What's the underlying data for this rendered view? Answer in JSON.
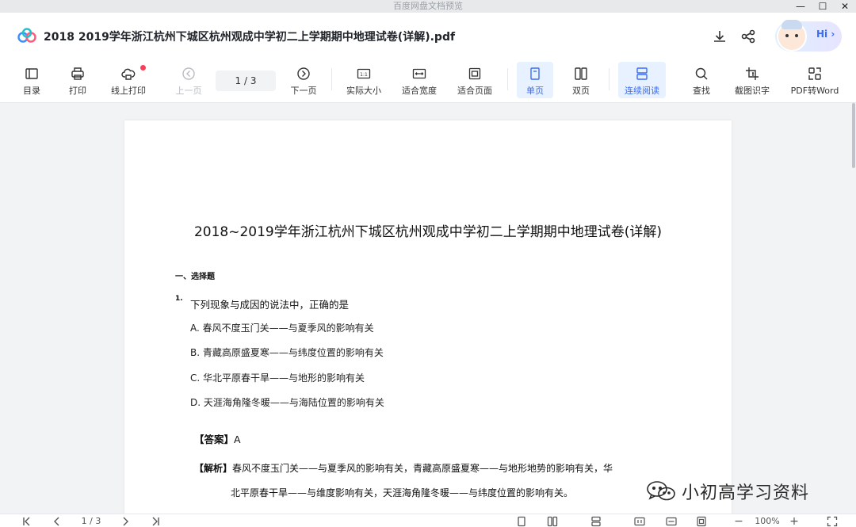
{
  "window": {
    "app_title": "百度网盘文档预览",
    "controls": {
      "minimize": "—",
      "maximize": "☐",
      "close": "✕"
    }
  },
  "header": {
    "doc_title": "2018  2019学年浙江杭州下城区杭州观成中学初二上学期期中地理试卷(详解).pdf",
    "assistant_label": "Hi ›",
    "icons": [
      "download-icon",
      "share-icon",
      "assistant-avatar"
    ]
  },
  "toolbar": {
    "catalog": "目录",
    "print": "打印",
    "online_print": "线上打印",
    "prev_page": "上一页",
    "page_indicator": "1  /  3",
    "next_page": "下一页",
    "actual_size": "实际大小",
    "fit_width": "适合宽度",
    "fit_page": "适合页面",
    "single_page": "单页",
    "double_page": "双页",
    "continuous": "连续阅读",
    "find": "查找",
    "ocr": "截图识字",
    "pdf_to_word": "PDF转Word"
  },
  "document": {
    "title": "2018~2019学年浙江杭州下城区杭州观成中学初二上学期期中地理试卷(详解)",
    "section": "一、选择题",
    "question_number": "1.",
    "question": "下列现象与成因的说法中，正确的是",
    "options": [
      "A. 春风不度玉门关——与夏季风的影响有关",
      "B. 青藏高原盛夏寒——与纬度位置的影响有关",
      "C. 华北平原春干旱——与地形的影响有关",
      "D. 天涯海角隆冬暖——与海陆位置的影响有关"
    ],
    "answer_label": "【答案】",
    "answer_value": "A",
    "explanation_label": "【解析】",
    "explanation_line1": "春风不度玉门关——与夏季风的影响有关，青藏高原盛夏寒——与地形地势的影响有关，华",
    "explanation_line2": "北平原春干旱——与维度影响有关，天涯海角隆冬暖——与纬度位置的影响有关。"
  },
  "watermark": {
    "text": "小初高学习资料"
  },
  "bottombar": {
    "page_indicator": "1 / 3",
    "zoom": "100%",
    "zoom_out": "−",
    "zoom_in": "+"
  },
  "colors": {
    "accent": "#3a6cf4",
    "active_bg": "#e8f1ff",
    "badge_red": "#ff3b5c"
  }
}
